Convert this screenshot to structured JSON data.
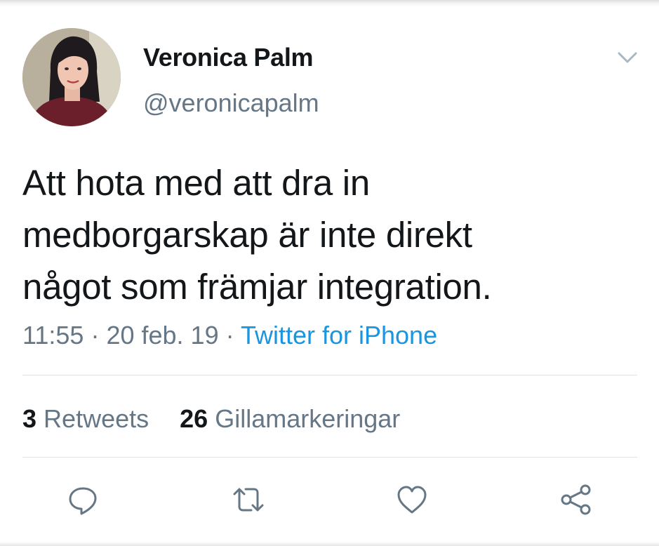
{
  "author": {
    "display_name": "Veronica Palm",
    "handle": "@veronicapalm"
  },
  "tweet": {
    "text_lines": [
      "Att hota med att dra in",
      "medborgarskap är inte direkt",
      "något som främjar integration."
    ],
    "time": "11:55",
    "date": "20 feb. 19",
    "separator": "·",
    "source": "Twitter for iPhone"
  },
  "stats": {
    "retweets_count": "3",
    "retweets_label": "Retweets",
    "likes_count": "26",
    "likes_label": "Gillamarkeringar"
  },
  "actions": [
    "reply-icon",
    "retweet-icon",
    "like-icon",
    "share-icon"
  ],
  "colors": {
    "text": "#14171a",
    "secondary": "#657786",
    "link": "#1b95e0",
    "divider": "#dfe3e6"
  }
}
